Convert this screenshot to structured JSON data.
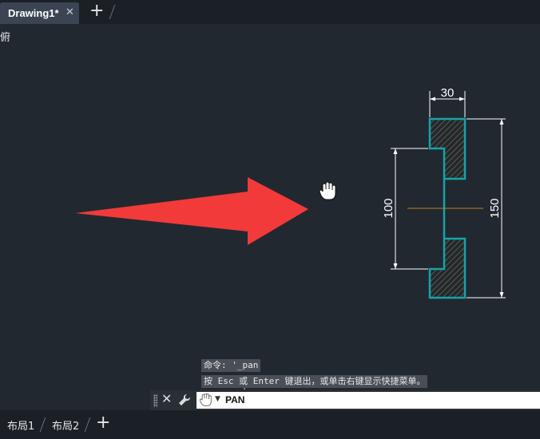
{
  "tabs": {
    "document": "Drawing1*",
    "close": "✕",
    "add": "+"
  },
  "view_label": "俯",
  "drawing": {
    "dim_top": "30",
    "dim_left": "100",
    "dim_right": "150",
    "colors": {
      "outline": "#16a3a8",
      "arrow": "#f23a3a",
      "hatch": "#8a7a45",
      "centerline": "#b58a1a",
      "dims": "#ffffff"
    }
  },
  "command": {
    "history": [
      "命令: '_pan",
      "按 Esc 或 Enter 键退出，或单击右键显示快捷菜单。"
    ],
    "close": "✕",
    "input_value": "PAN"
  },
  "layouts": {
    "tabs": [
      "布局1",
      "布局2"
    ],
    "add": "+"
  }
}
